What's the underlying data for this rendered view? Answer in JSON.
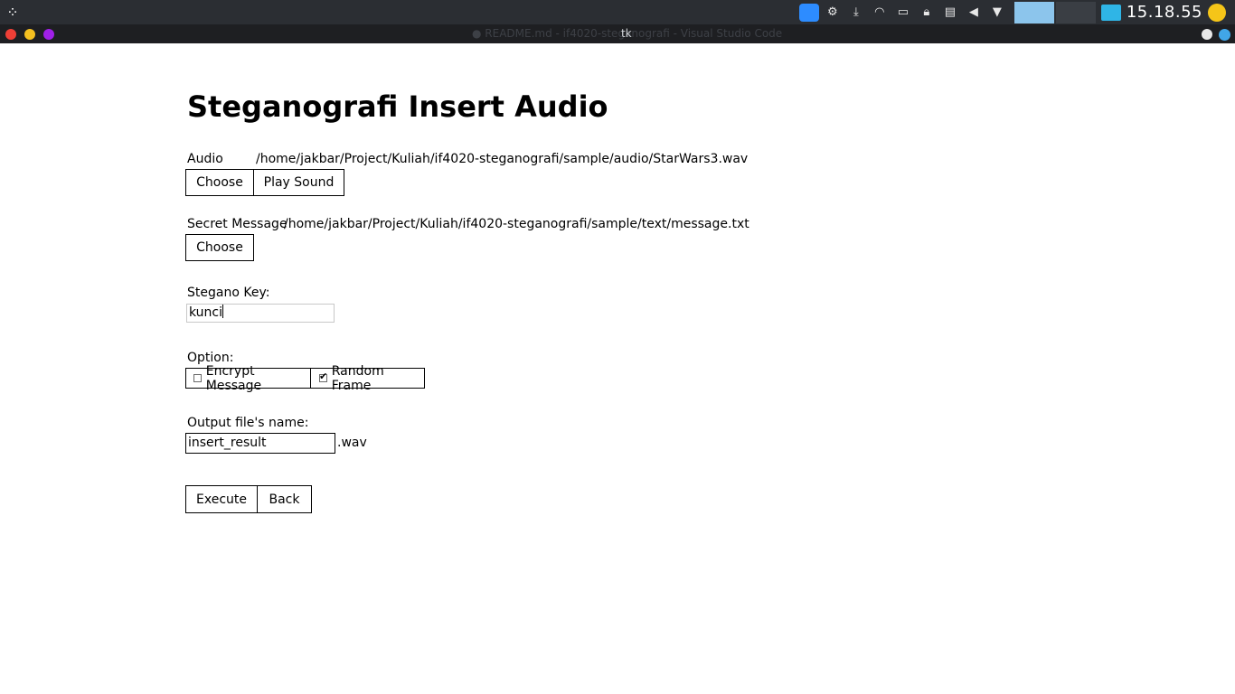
{
  "system_panel": {
    "clock": "15.18.55",
    "tray_icons": [
      "zoom-icon",
      "settings-icon",
      "download-icon",
      "wifi-icon",
      "battery-icon",
      "lock-icon",
      "clipboard-icon",
      "volume-icon",
      "dropdown-icon"
    ]
  },
  "window": {
    "title": "tk",
    "background_title": "● README.md - if4020-steganografi - Visual Studio Code"
  },
  "app": {
    "heading": "Steganografi Insert Audio",
    "audio": {
      "label": "Audio",
      "path": "/home/jakbar/Project/Kuliah/if4020-steganografi/sample/audio/StarWars3.wav",
      "choose_label": "Choose",
      "play_label": "Play Sound"
    },
    "secret": {
      "label": "Secret Message",
      "path": "/home/jakbar/Project/Kuliah/if4020-steganografi/sample/text/message.txt",
      "choose_label": "Choose"
    },
    "key": {
      "label": "Stegano Key:",
      "value": "kunci"
    },
    "option": {
      "label": "Option:",
      "encrypt_label": "Encrypt Message",
      "encrypt_checked": false,
      "random_label": "Random Frame",
      "random_checked": true
    },
    "output": {
      "label": "Output file's name:",
      "value": "insert_result",
      "suffix": ".wav"
    },
    "execute_label": "Execute",
    "back_label": "Back"
  }
}
